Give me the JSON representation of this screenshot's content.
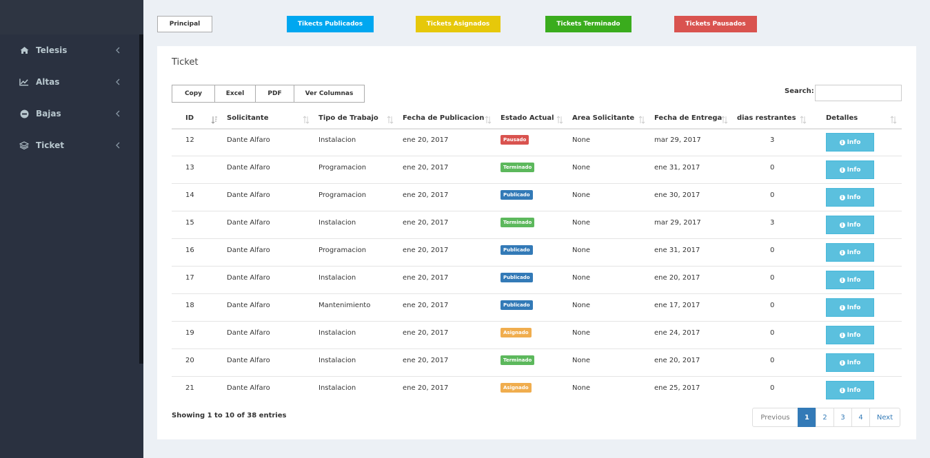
{
  "sidebar": {
    "items": [
      {
        "label": "Telesis",
        "icon": "home-icon"
      },
      {
        "label": "Altas",
        "icon": "line-chart-icon"
      },
      {
        "label": "Bajas",
        "icon": "minus-circle-icon"
      },
      {
        "label": "Ticket",
        "icon": "layers-icon"
      }
    ]
  },
  "topbar": {
    "principal": "Principal",
    "publicados": "Tikects Publicados",
    "asignados": "Tickets Asignados",
    "terminado": "Tickets Terminado",
    "pausados": "Tickets Pausados"
  },
  "colors": {
    "publicados": "#00a7f0",
    "asignados": "#e6c80a",
    "terminado": "#3aac1d",
    "pausados": "#d9534f",
    "badge_pausado": "#d9534f",
    "badge_terminado": "#5cb85c",
    "badge_publicado": "#337ab7",
    "badge_asignado": "#f0ad4e"
  },
  "card": {
    "title": "Ticket",
    "export_buttons": [
      "Copy",
      "Excel",
      "PDF",
      "Ver Columnas"
    ],
    "search_label": "Search:",
    "search_value": ""
  },
  "table": {
    "columns": [
      "ID",
      "Solicitante",
      "Tipo de Trabajo",
      "Fecha de Publicacion",
      "Estado Actual",
      "Area Solicitante",
      "Fecha de Entrega",
      "dias restrantes",
      "Detalles"
    ],
    "info_label": "Info",
    "rows": [
      {
        "id": "12",
        "solicitante": "Dante Alfaro",
        "tipo": "Instalacion",
        "publicacion": "ene 20, 2017",
        "estado": "Pausado",
        "estado_kind": "pausado",
        "area": "None",
        "entrega": "mar 29, 2017",
        "dias": "3"
      },
      {
        "id": "13",
        "solicitante": "Dante Alfaro",
        "tipo": "Programacion",
        "publicacion": "ene 20, 2017",
        "estado": "Terminado",
        "estado_kind": "terminado",
        "area": "None",
        "entrega": "ene 31, 2017",
        "dias": "0"
      },
      {
        "id": "14",
        "solicitante": "Dante Alfaro",
        "tipo": "Programacion",
        "publicacion": "ene 20, 2017",
        "estado": "Publicado",
        "estado_kind": "publicado",
        "area": "None",
        "entrega": "ene 30, 2017",
        "dias": "0"
      },
      {
        "id": "15",
        "solicitante": "Dante Alfaro",
        "tipo": "Instalacion",
        "publicacion": "ene 20, 2017",
        "estado": "Terminado",
        "estado_kind": "terminado",
        "area": "None",
        "entrega": "mar 29, 2017",
        "dias": "3"
      },
      {
        "id": "16",
        "solicitante": "Dante Alfaro",
        "tipo": "Programacion",
        "publicacion": "ene 20, 2017",
        "estado": "Publicado",
        "estado_kind": "publicado",
        "area": "None",
        "entrega": "ene 31, 2017",
        "dias": "0"
      },
      {
        "id": "17",
        "solicitante": "Dante Alfaro",
        "tipo": "Instalacion",
        "publicacion": "ene 20, 2017",
        "estado": "Publicado",
        "estado_kind": "publicado",
        "area": "None",
        "entrega": "ene 20, 2017",
        "dias": "0"
      },
      {
        "id": "18",
        "solicitante": "Dante Alfaro",
        "tipo": "Mantenimiento",
        "publicacion": "ene 20, 2017",
        "estado": "Publicado",
        "estado_kind": "publicado",
        "area": "None",
        "entrega": "ene 17, 2017",
        "dias": "0"
      },
      {
        "id": "19",
        "solicitante": "Dante Alfaro",
        "tipo": "Instalacion",
        "publicacion": "ene 20, 2017",
        "estado": "Asignado",
        "estado_kind": "asignado",
        "area": "None",
        "entrega": "ene 24, 2017",
        "dias": "0"
      },
      {
        "id": "20",
        "solicitante": "Dante Alfaro",
        "tipo": "Instalacion",
        "publicacion": "ene 20, 2017",
        "estado": "Terminado",
        "estado_kind": "terminado",
        "area": "None",
        "entrega": "ene 20, 2017",
        "dias": "0"
      },
      {
        "id": "21",
        "solicitante": "Dante Alfaro",
        "tipo": "Instalacion",
        "publicacion": "ene 20, 2017",
        "estado": "Asignado",
        "estado_kind": "asignado",
        "area": "None",
        "entrega": "ene 25, 2017",
        "dias": "0"
      }
    ]
  },
  "footer": {
    "showing": "Showing 1 to 10 of 38 entries",
    "pagination": {
      "previous": "Previous",
      "pages": [
        "1",
        "2",
        "3",
        "4"
      ],
      "next": "Next",
      "current": "1"
    }
  }
}
